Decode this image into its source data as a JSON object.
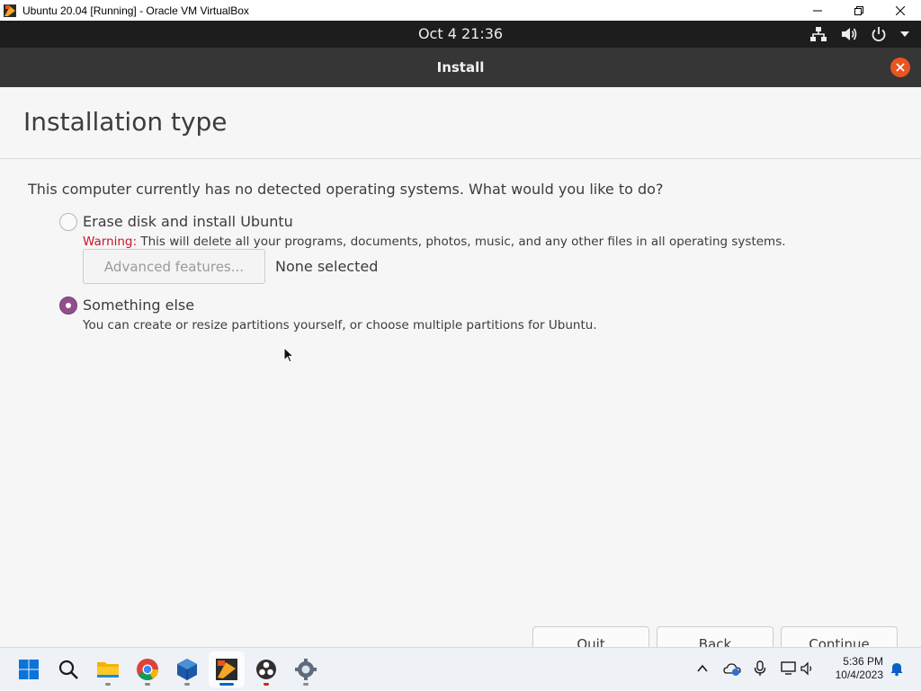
{
  "window": {
    "title": "Ubuntu 20.04 [Running] - Oracle VM VirtualBox",
    "controls": [
      "minimize-icon",
      "restore-icon",
      "close-icon"
    ]
  },
  "panel": {
    "clock": "Oct 4  21:36",
    "tray_icons": [
      "network-icon",
      "volume-icon",
      "power-icon",
      "dropdown-arrow-icon"
    ]
  },
  "installer": {
    "header_title": "Install",
    "page_title": "Installation type",
    "question": "This computer currently has no detected operating systems. What would you like to do?",
    "options": [
      {
        "label": "Erase disk and install Ubuntu",
        "selected": false,
        "warning_label": "Warning:",
        "warning_text": " This will delete all your programs, documents, photos, music, and any other files in all operating systems.",
        "advanced_button": "Advanced features...",
        "advanced_status": "None selected"
      },
      {
        "label": "Something else",
        "selected": true,
        "description": "You can create or resize partitions yourself, or choose multiple partitions for Ubuntu."
      }
    ],
    "buttons": {
      "quit": "Quit",
      "back": "Back",
      "continue": "Continue"
    },
    "accent_color": "#e95420",
    "radio_selected_color": "#924d8b"
  },
  "taskbar": {
    "apps": [
      "windows-start-icon",
      "search-icon",
      "file-explorer-icon",
      "chrome-icon",
      "virtualbox-icon",
      "ubuntu-vm-icon",
      "obs-icon",
      "settings-icon"
    ],
    "tray_icons": [
      "chevron-up-icon",
      "onedrive-icon",
      "microphone-icon",
      "display-icon",
      "speaker-icon",
      "notification-bell-icon"
    ],
    "time": "5:36 PM",
    "date": "10/4/2023"
  }
}
